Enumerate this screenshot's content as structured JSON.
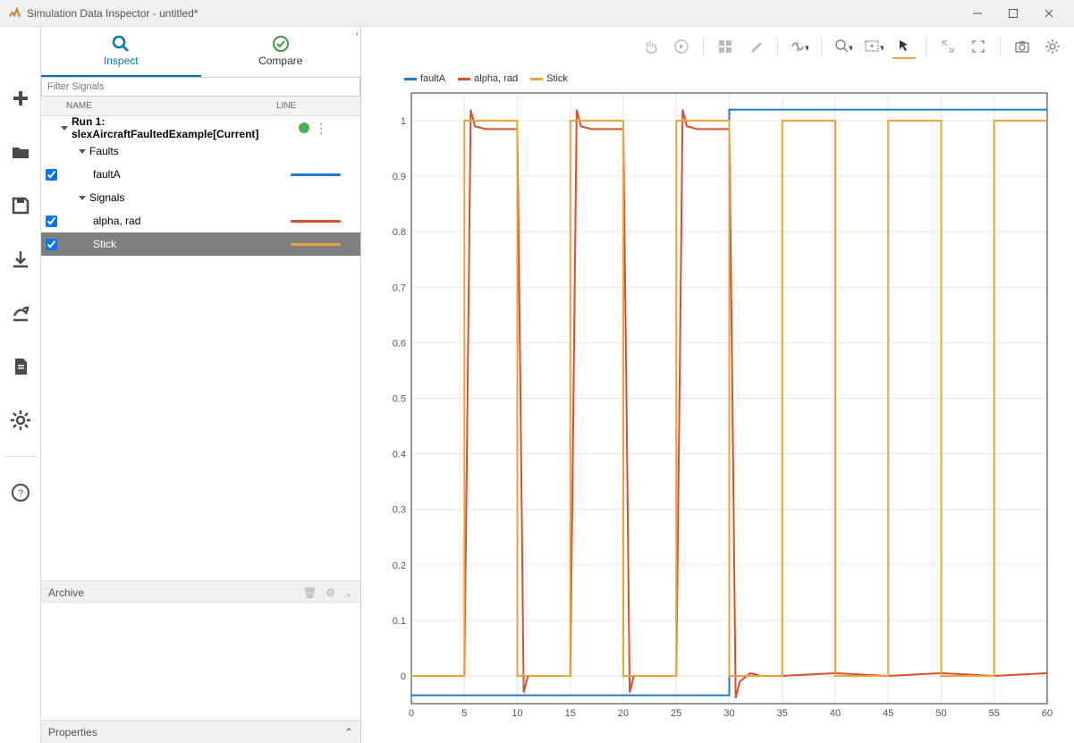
{
  "window": {
    "title": "Simulation Data Inspector - untitled*"
  },
  "tabs": {
    "inspect": "Inspect",
    "compare": "Compare",
    "active": "inspect"
  },
  "filter": {
    "placeholder": "Filter Signals"
  },
  "headers": {
    "name": "NAME",
    "line": "LINE"
  },
  "archive": {
    "label": "Archive"
  },
  "properties": {
    "label": "Properties"
  },
  "tree": {
    "run": {
      "label": "Run 1: slexAircraftFaultedExample[Current]"
    },
    "groups": [
      {
        "label": "Faults",
        "signals": [
          {
            "label": "faultA",
            "checked": true,
            "color": "#1f77d4",
            "selected": false
          }
        ]
      },
      {
        "label": "Signals",
        "signals": [
          {
            "label": "alpha, rad",
            "checked": true,
            "color": "#d94f2a",
            "selected": false
          },
          {
            "label": "Stick",
            "checked": true,
            "color": "#e8a33d",
            "selected": true
          }
        ]
      }
    ]
  },
  "chart_data": {
    "type": "line",
    "xlim": [
      0,
      60
    ],
    "ylim": [
      -0.05,
      1.05
    ],
    "xticks": [
      0,
      5,
      10,
      15,
      20,
      25,
      30,
      35,
      40,
      45,
      50,
      55,
      60
    ],
    "yticks": [
      0,
      0.1,
      0.2,
      0.3,
      0.4,
      0.5,
      0.6,
      0.7,
      0.8,
      0.9,
      1.0
    ],
    "series": [
      {
        "name": "faultA",
        "color": "#1f77d4",
        "x": [
          0,
          30,
          30,
          60
        ],
        "y": [
          -0.035,
          -0.035,
          1.02,
          1.02
        ]
      },
      {
        "name": "alpha, rad",
        "color": "#d94f2a",
        "x": [
          0,
          5,
          5.3,
          5.6,
          6,
          7,
          10,
          10.3,
          10.6,
          11,
          12,
          15,
          15.3,
          15.6,
          16,
          17,
          20,
          20.3,
          20.6,
          21,
          22,
          25,
          25.3,
          25.6,
          26,
          27,
          30,
          30.3,
          30.6,
          31,
          32,
          33,
          35,
          40,
          45,
          50,
          55,
          60
        ],
        "y": [
          0,
          0,
          0.5,
          1.02,
          0.99,
          0.985,
          0.985,
          0.5,
          -0.03,
          0,
          0,
          0,
          0.5,
          1.02,
          0.99,
          0.985,
          0.985,
          0.5,
          -0.03,
          0,
          0,
          0,
          0.5,
          1.02,
          0.99,
          0.985,
          0.985,
          0.5,
          -0.04,
          -0.01,
          0.005,
          0,
          0,
          0.005,
          0,
          0.005,
          0,
          0.005
        ]
      },
      {
        "name": "Stick",
        "color": "#e8a33d",
        "x": [
          0,
          5,
          5,
          10,
          10,
          15,
          15,
          20,
          20,
          25,
          25,
          30,
          30,
          35,
          35,
          40,
          40,
          45,
          45,
          50,
          50,
          55,
          55,
          60
        ],
        "y": [
          0,
          0,
          1,
          1,
          0,
          0,
          1,
          1,
          0,
          0,
          1,
          1,
          0,
          0,
          1,
          1,
          0,
          0,
          1,
          1,
          0,
          0,
          1,
          1
        ]
      }
    ]
  }
}
